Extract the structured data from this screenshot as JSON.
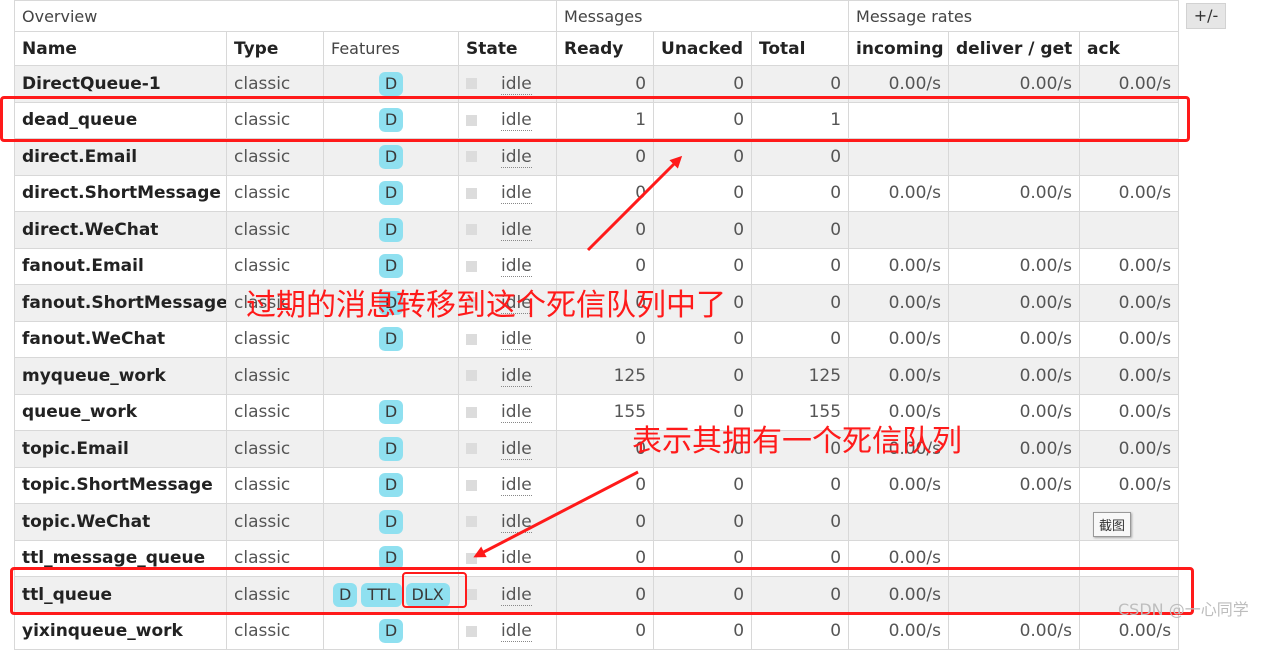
{
  "toggle_label": "+/-",
  "groups": {
    "overview": "Overview",
    "messages": "Messages",
    "message_rates": "Message rates"
  },
  "columns": {
    "name": "Name",
    "type": "Type",
    "features": "Features",
    "state": "State",
    "ready": "Ready",
    "unacked": "Unacked",
    "total": "Total",
    "incoming": "incoming",
    "deliver_get": "deliver / get",
    "ack": "ack"
  },
  "rows": [
    {
      "name": "DirectQueue-1",
      "type": "classic",
      "features": [
        "D"
      ],
      "state": "idle",
      "ready": "0",
      "unacked": "0",
      "total": "0",
      "incoming": "0.00/s",
      "deliver_get": "0.00/s",
      "ack": "0.00/s"
    },
    {
      "name": "dead_queue",
      "type": "classic",
      "features": [
        "D"
      ],
      "state": "idle",
      "ready": "1",
      "unacked": "0",
      "total": "1",
      "incoming": "",
      "deliver_get": "",
      "ack": ""
    },
    {
      "name": "direct.Email",
      "type": "classic",
      "features": [
        "D"
      ],
      "state": "idle",
      "ready": "0",
      "unacked": "0",
      "total": "0",
      "incoming": "",
      "deliver_get": "",
      "ack": ""
    },
    {
      "name": "direct.ShortMessage",
      "type": "classic",
      "features": [
        "D"
      ],
      "state": "idle",
      "ready": "0",
      "unacked": "0",
      "total": "0",
      "incoming": "0.00/s",
      "deliver_get": "0.00/s",
      "ack": "0.00/s"
    },
    {
      "name": "direct.WeChat",
      "type": "classic",
      "features": [
        "D"
      ],
      "state": "idle",
      "ready": "0",
      "unacked": "0",
      "total": "0",
      "incoming": "",
      "deliver_get": "",
      "ack": ""
    },
    {
      "name": "fanout.Email",
      "type": "classic",
      "features": [
        "D"
      ],
      "state": "idle",
      "ready": "0",
      "unacked": "0",
      "total": "0",
      "incoming": "0.00/s",
      "deliver_get": "0.00/s",
      "ack": "0.00/s"
    },
    {
      "name": "fanout.ShortMessage",
      "type": "classic",
      "features": [
        "D"
      ],
      "state": "idle",
      "ready": "0",
      "unacked": "0",
      "total": "0",
      "incoming": "0.00/s",
      "deliver_get": "0.00/s",
      "ack": "0.00/s"
    },
    {
      "name": "fanout.WeChat",
      "type": "classic",
      "features": [
        "D"
      ],
      "state": "idle",
      "ready": "0",
      "unacked": "0",
      "total": "0",
      "incoming": "0.00/s",
      "deliver_get": "0.00/s",
      "ack": "0.00/s"
    },
    {
      "name": "myqueue_work",
      "type": "classic",
      "features": [],
      "state": "idle",
      "ready": "125",
      "unacked": "0",
      "total": "125",
      "incoming": "0.00/s",
      "deliver_get": "0.00/s",
      "ack": "0.00/s"
    },
    {
      "name": "queue_work",
      "type": "classic",
      "features": [
        "D"
      ],
      "state": "idle",
      "ready": "155",
      "unacked": "0",
      "total": "155",
      "incoming": "0.00/s",
      "deliver_get": "0.00/s",
      "ack": "0.00/s"
    },
    {
      "name": "topic.Email",
      "type": "classic",
      "features": [
        "D"
      ],
      "state": "idle",
      "ready": "0",
      "unacked": "0",
      "total": "0",
      "incoming": "0.00/s",
      "deliver_get": "0.00/s",
      "ack": "0.00/s"
    },
    {
      "name": "topic.ShortMessage",
      "type": "classic",
      "features": [
        "D"
      ],
      "state": "idle",
      "ready": "0",
      "unacked": "0",
      "total": "0",
      "incoming": "0.00/s",
      "deliver_get": "0.00/s",
      "ack": "0.00/s"
    },
    {
      "name": "topic.WeChat",
      "type": "classic",
      "features": [
        "D"
      ],
      "state": "idle",
      "ready": "0",
      "unacked": "0",
      "total": "0",
      "incoming": "",
      "deliver_get": "",
      "ack": ""
    },
    {
      "name": "ttl_message_queue",
      "type": "classic",
      "features": [
        "D"
      ],
      "state": "idle",
      "ready": "0",
      "unacked": "0",
      "total": "0",
      "incoming": "0.00/s",
      "deliver_get": "",
      "ack": ""
    },
    {
      "name": "ttl_queue",
      "type": "classic",
      "features": [
        "D",
        "TTL",
        "DLX"
      ],
      "state": "idle",
      "ready": "0",
      "unacked": "0",
      "total": "0",
      "incoming": "0.00/s",
      "deliver_get": "",
      "ack": ""
    },
    {
      "name": "yixinqueue_work",
      "type": "classic",
      "features": [
        "D"
      ],
      "state": "idle",
      "ready": "0",
      "unacked": "0",
      "total": "0",
      "incoming": "0.00/s",
      "deliver_get": "0.00/s",
      "ack": "0.00/s"
    }
  ],
  "annotations": {
    "dead_queue_note": "过期的消息转移到这个死信队列中了",
    "dlx_note": "表示其拥有一个死信队列"
  },
  "tooltip": "截图",
  "watermark": "CSDN @一心同学",
  "colors": {
    "highlight": "#ff1a1a",
    "feature_tag": "#8fe0f0"
  }
}
